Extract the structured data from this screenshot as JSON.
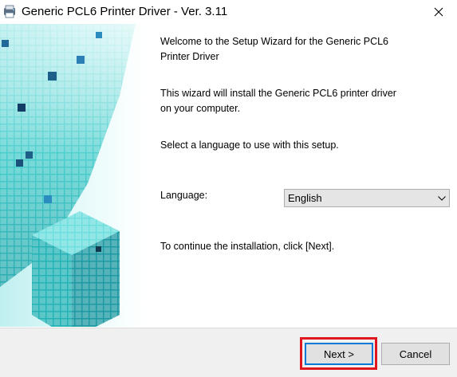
{
  "window": {
    "title": "Generic PCL6 Printer Driver - Ver. 3.11",
    "close_glyph": "✕"
  },
  "content": {
    "welcome_line1": "Welcome to the Setup Wizard for the Generic PCL6",
    "welcome_line2": "Printer Driver",
    "desc_line1": "This wizard will install the Generic PCL6 printer driver",
    "desc_line2": "on your computer.",
    "select_language_prompt": "Select a language to use with this setup.",
    "language_label": "Language:",
    "language_value": "English",
    "continue_text": "To continue the installation, click [Next]."
  },
  "buttons": {
    "next": "Next >",
    "cancel": "Cancel"
  },
  "colors": {
    "accent_cyan": "#27c4c4",
    "highlight_red": "#e0161e",
    "focus_blue": "#0078d7"
  }
}
